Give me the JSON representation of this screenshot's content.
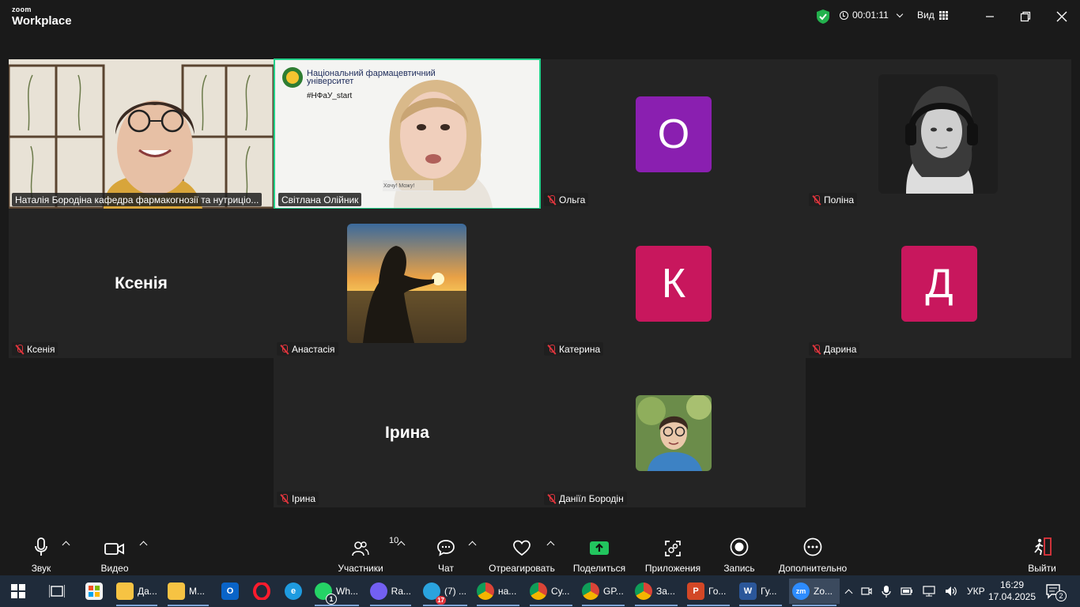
{
  "app": {
    "brand_top": "zoom",
    "brand_bottom": "Workplace"
  },
  "header": {
    "timer": "00:01:11",
    "view_label": "Вид"
  },
  "tiles": [
    {
      "id": "natalia",
      "name": "Наталія Бородіна кафедра фармакогнозії та нутриціо...",
      "muted": false
    },
    {
      "id": "svitlana",
      "name": "Світлана Олійник",
      "muted": false,
      "overlay_org": "Національний фармацевтичний університет",
      "overlay_tag": "#НФаУ_start",
      "overlay_small": "Хочу! Можу!"
    },
    {
      "id": "olga",
      "name": "Ольга",
      "muted": true,
      "initial": "О",
      "color": "#8a1fb0"
    },
    {
      "id": "polina",
      "name": "Поліна",
      "muted": true
    },
    {
      "id": "ksenia",
      "name": "Ксенія",
      "muted": true,
      "bigname": "Ксенія"
    },
    {
      "id": "anastasia",
      "name": "Анастасія",
      "muted": true
    },
    {
      "id": "kateryna",
      "name": "Катерина",
      "muted": true,
      "initial": "К",
      "color": "#c8175d"
    },
    {
      "id": "daryna",
      "name": "Дарина",
      "muted": true,
      "initial": "Д",
      "color": "#c8175d"
    },
    {
      "id": "iryna",
      "name": "Ірина",
      "muted": true,
      "bigname": "Ірина"
    },
    {
      "id": "daniil",
      "name": "Даніїл Бородін",
      "muted": true
    }
  ],
  "toolbar": {
    "audio": "Звук",
    "video": "Видео",
    "participants": "Участники",
    "participants_count": "10",
    "chat": "Чат",
    "react": "Отреагировать",
    "share": "Поделиться",
    "apps": "Приложения",
    "record": "Запись",
    "more": "Дополнительно",
    "leave": "Выйти"
  },
  "taskbar": {
    "items": [
      {
        "label": "Да...",
        "icon": "folder-icon"
      },
      {
        "label": "М...",
        "icon": "folder-icon"
      },
      {
        "label": "Wh...",
        "icon": "whatsapp-icon",
        "badge": "1"
      },
      {
        "label": "Ra...",
        "icon": "viber-icon"
      },
      {
        "label": "(7) ...",
        "icon": "telegram-icon",
        "badge": "17"
      },
      {
        "label": "на...",
        "icon": "chrome-icon"
      },
      {
        "label": "Су...",
        "icon": "chrome-icon"
      },
      {
        "label": "GP...",
        "icon": "chrome-icon"
      },
      {
        "label": "За...",
        "icon": "chrome-icon"
      },
      {
        "label": "Го...",
        "icon": "powerpoint-icon"
      },
      {
        "label": "Гу...",
        "icon": "word-icon"
      },
      {
        "label": "Zo...",
        "icon": "zoom-icon"
      }
    ],
    "lang": "УКР",
    "time": "16:29",
    "date": "17.04.2025",
    "notifications": "2"
  },
  "colors": {
    "accent_green": "#23d18b",
    "share_green": "#22c55e",
    "leave_red": "#e0353d",
    "olga": "#8a1fb0",
    "pink": "#c8175d"
  }
}
